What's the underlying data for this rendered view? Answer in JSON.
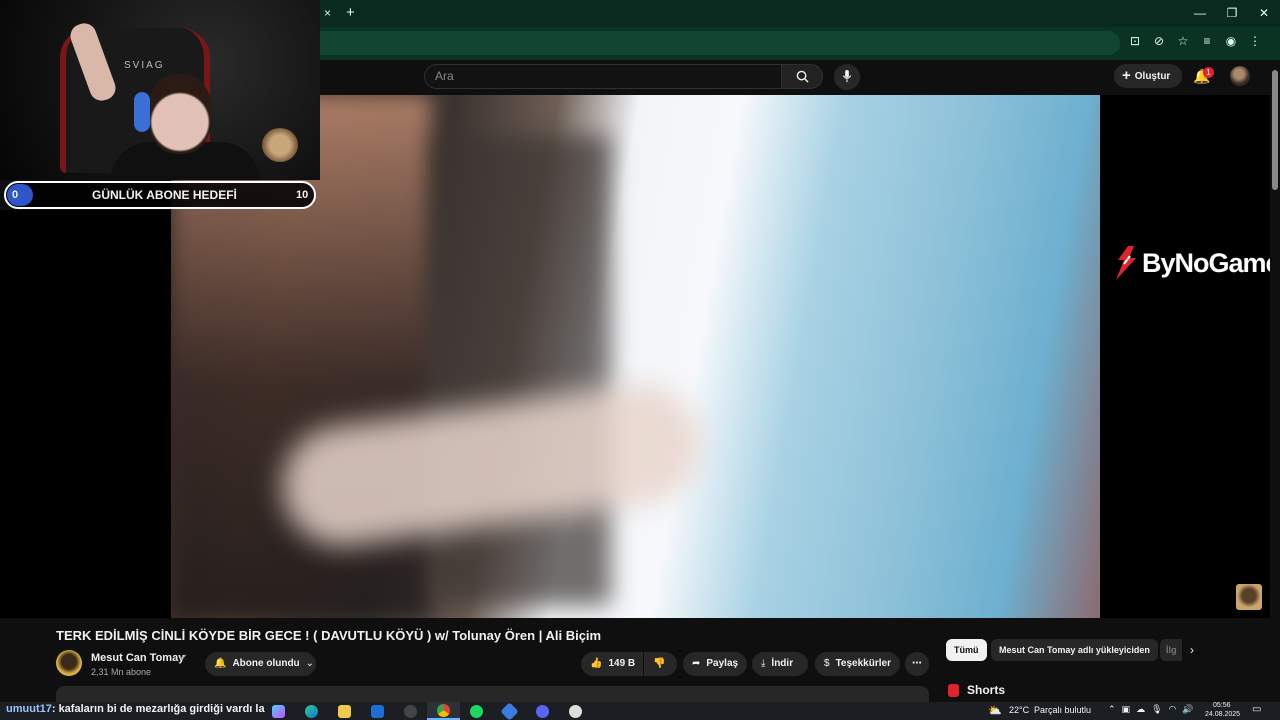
{
  "browser": {
    "tab_close": "×",
    "new_tab": "+",
    "window_controls": [
      "—",
      "❐",
      "✕"
    ]
  },
  "header": {
    "search_placeholder": "Ara",
    "create_label": "Oluştur",
    "notification_count": "1"
  },
  "overlay": {
    "goal_current": "0",
    "goal_label": "GÜNLÜK ABONE HEDEFİ",
    "goal_max": "10",
    "chair_brand": "SVIAG",
    "sponsor": "ByNoGame"
  },
  "video": {
    "title": "TERK EDİLMİŞ CİNLİ KÖYDE BİR GECE ! ( DAVUTLU KÖYÜ ) w/ Tolunay Ören | Ali Biçim",
    "channel_name": "Mesut Can Tomay",
    "subscribers": "2,31 Mn abone",
    "subscribe_label": "Abone olundu",
    "likes": "149 B",
    "share_label": "Paylaş",
    "download_label": "İndir",
    "thanks_label": "Teşekkürler",
    "more_label": "⋯"
  },
  "sidebar": {
    "chips": [
      "Tümü",
      "Mesut Can Tomay adlı yükleyiciden",
      "İlg"
    ],
    "shorts_label": "Shorts"
  },
  "chat": {
    "user": "umuut17",
    "message": ": kafaların bi de mezarlığa girdiği vardı la"
  },
  "taskbar": {
    "temperature": "22°C",
    "weather": "Parçalı bulutlu",
    "time": "05:56",
    "date": "24.08.2025"
  },
  "colors": {
    "accent_red": "#e3232c",
    "goal_blue": "#2f56c8",
    "browser_green": "#0b3324"
  }
}
